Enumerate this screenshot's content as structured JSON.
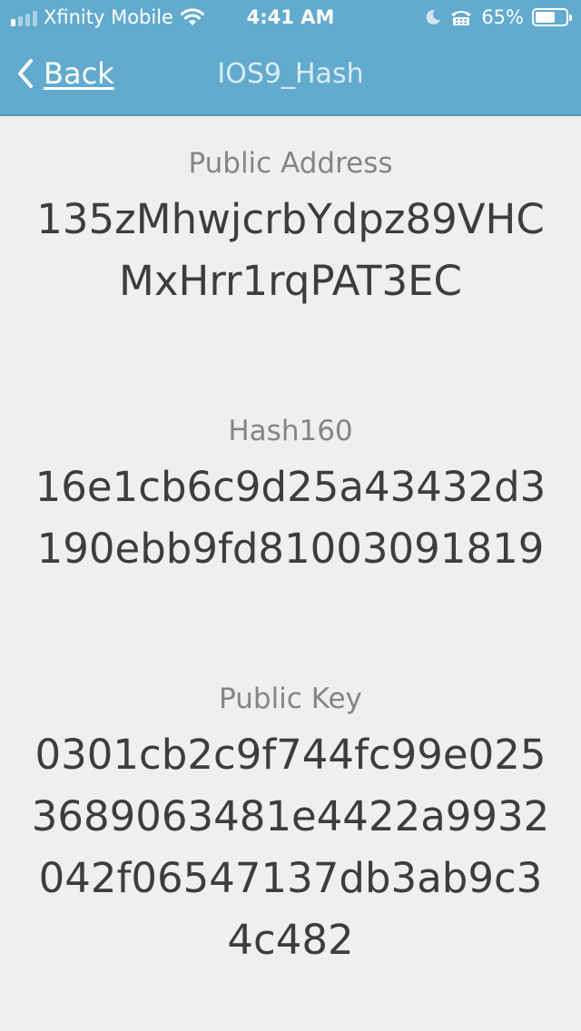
{
  "status_bar": {
    "carrier": "Xfinity Mobile",
    "time": "4:41 AM",
    "battery_percent": "65%",
    "battery_level": 0.65,
    "signal_bars_filled": 1,
    "icons": [
      "signal-icon",
      "wifi-icon",
      "moon-icon",
      "tty-icon",
      "battery-icon"
    ]
  },
  "nav": {
    "back_label": "Back",
    "title": "IOS9_Hash"
  },
  "sections": [
    {
      "label": "Public Address",
      "value": "135zMhwjcrbYdpz89VHCMxHrr1rqPAT3EC"
    },
    {
      "label": "Hash160",
      "value": "16e1cb6c9d25a43432d3190ebb9fd81003091819"
    },
    {
      "label": "Public Key",
      "value": "0301cb2c9f744fc99e0253689063481e4422a9932042f06547137db3ab9c34c482"
    }
  ],
  "colors": {
    "header_background": "#62aace",
    "page_background": "#efefef",
    "label_text": "#858585",
    "value_text": "#3d3d3d"
  }
}
